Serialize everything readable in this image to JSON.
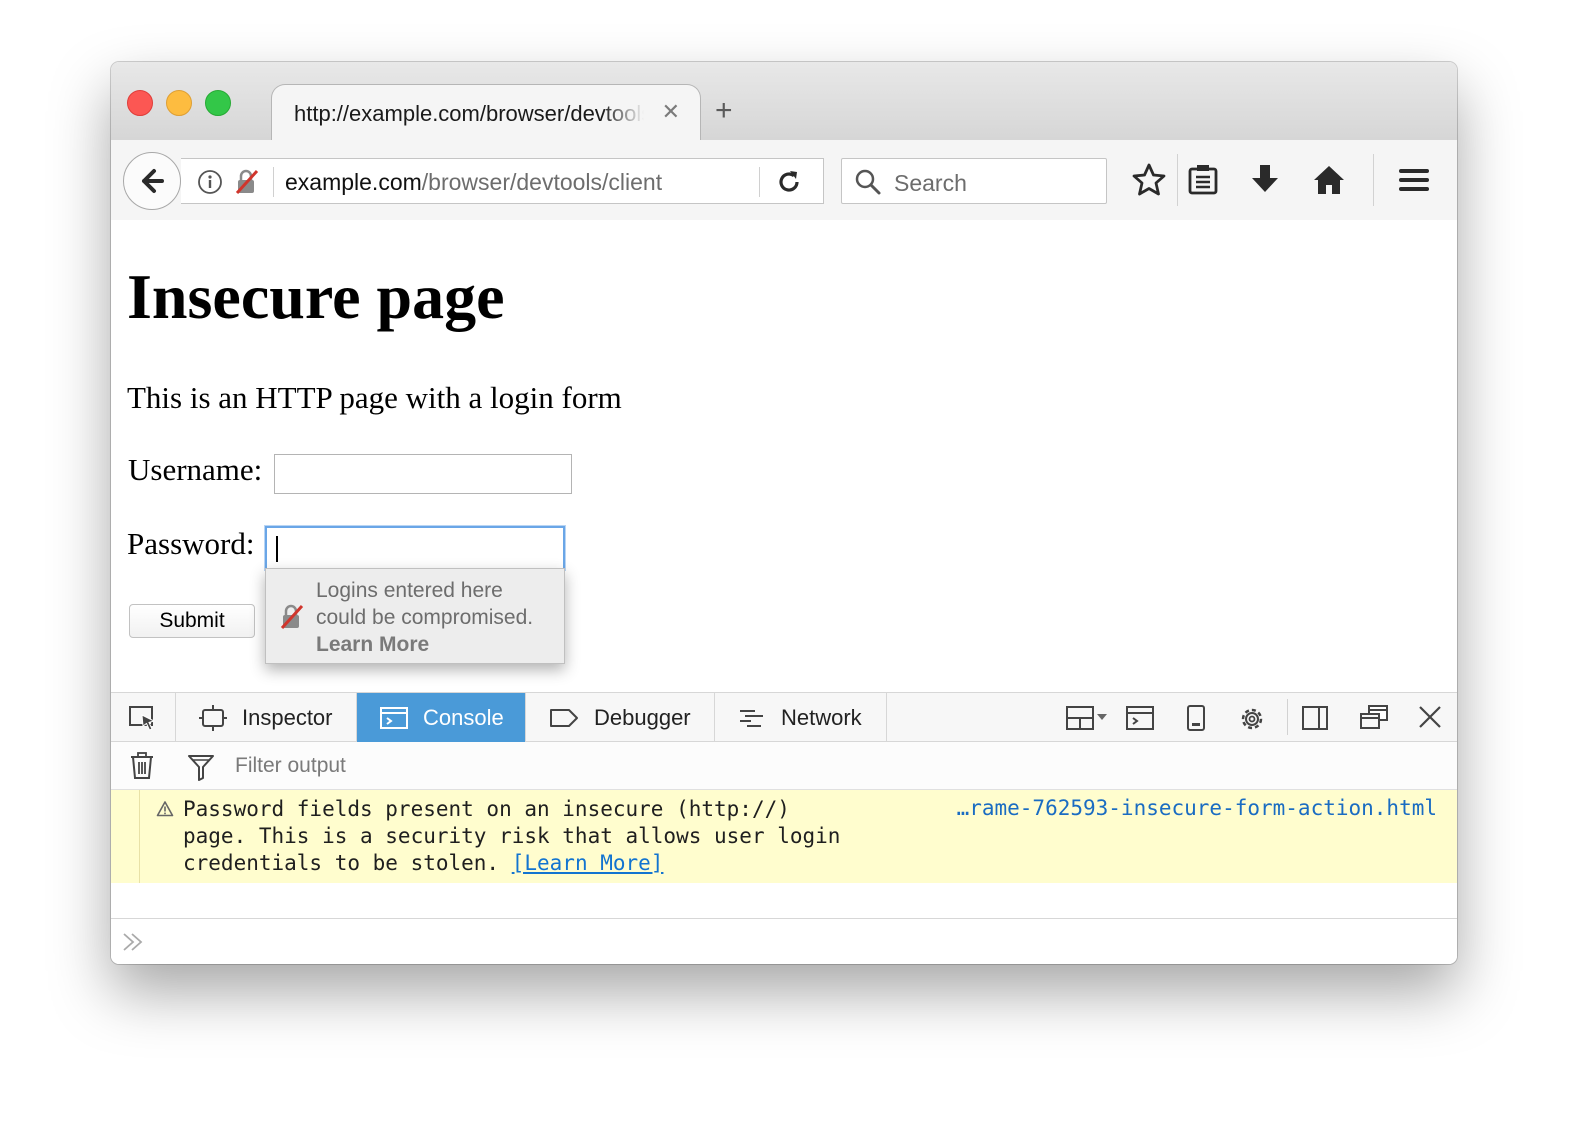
{
  "tab": {
    "title": "http://example.com/browser/devtools/client",
    "close": "✕",
    "new_tab": "+"
  },
  "urlbar": {
    "host": "example.com",
    "path": "/browser/devtools/client"
  },
  "search": {
    "placeholder": "Search"
  },
  "page": {
    "heading": "Insecure page",
    "description": "This is an HTTP page with a login form",
    "username_label": "Username:",
    "password_label": "Password:",
    "submit_label": "Submit"
  },
  "popup": {
    "line1": "Logins entered here",
    "line2": "could be compromised.",
    "link": "Learn More"
  },
  "devtools": {
    "tabs": [
      {
        "label": "Inspector"
      },
      {
        "label": "Console"
      },
      {
        "label": "Debugger"
      },
      {
        "label": "Network"
      }
    ],
    "active_tab": "Console",
    "active_color": "#4a9ad8",
    "filter_placeholder": "Filter output"
  },
  "console": {
    "warning": {
      "text": "Password fields present on an insecure (http://)\npage. This is a security risk that allows user login\ncredentials to be stolen. ",
      "link": "[Learn More]",
      "source": "…rame-762593-insecure-form-action.html"
    }
  },
  "colors": {
    "warning_bg": "#fffdce",
    "link": "#1274d0",
    "insecure_lock": "#d0352c"
  }
}
